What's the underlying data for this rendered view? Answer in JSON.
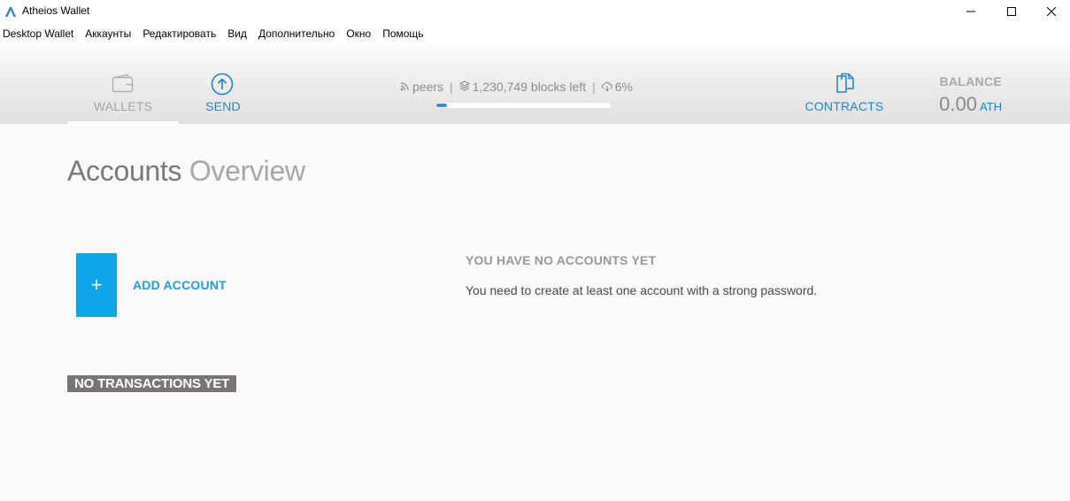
{
  "window": {
    "title": "Atheios Wallet"
  },
  "menu": {
    "items": [
      "Desktop Wallet",
      "Аккаунты",
      "Редактировать",
      "Вид",
      "Дополнительно",
      "Окно",
      "Помощь"
    ]
  },
  "header": {
    "nav": {
      "wallets_label": "WALLETS",
      "send_label": "SEND",
      "contracts_label": "CONTRACTS"
    },
    "sync": {
      "peers": "peers",
      "blocks_left": "1,230,749 blocks left",
      "percent": "6%",
      "separator": "|",
      "progress": 0.06
    },
    "balance": {
      "label": "BALANCE",
      "value": "0.00",
      "unit": "ATH"
    }
  },
  "main": {
    "title_bold": "Accounts",
    "title_light": "Overview",
    "add_account": {
      "plus": "+",
      "label": "ADD ACCOUNT"
    },
    "no_accounts": {
      "title": "YOU HAVE NO ACCOUNTS YET",
      "description": "You need to create at least one account with a strong password."
    },
    "no_transactions": "NO TRANSACTIONS YET"
  },
  "colors": {
    "accent": "#1b87c9",
    "add_button": "#0ea5e9",
    "badge": "#7a7574"
  },
  "icons": {
    "app": "atheios-logo-icon",
    "wallets": "wallet-icon",
    "send": "arrow-up-circle-icon",
    "contracts": "documents-icon",
    "peers": "signal-icon",
    "blocks": "layers-icon",
    "download": "cloud-download-icon"
  }
}
